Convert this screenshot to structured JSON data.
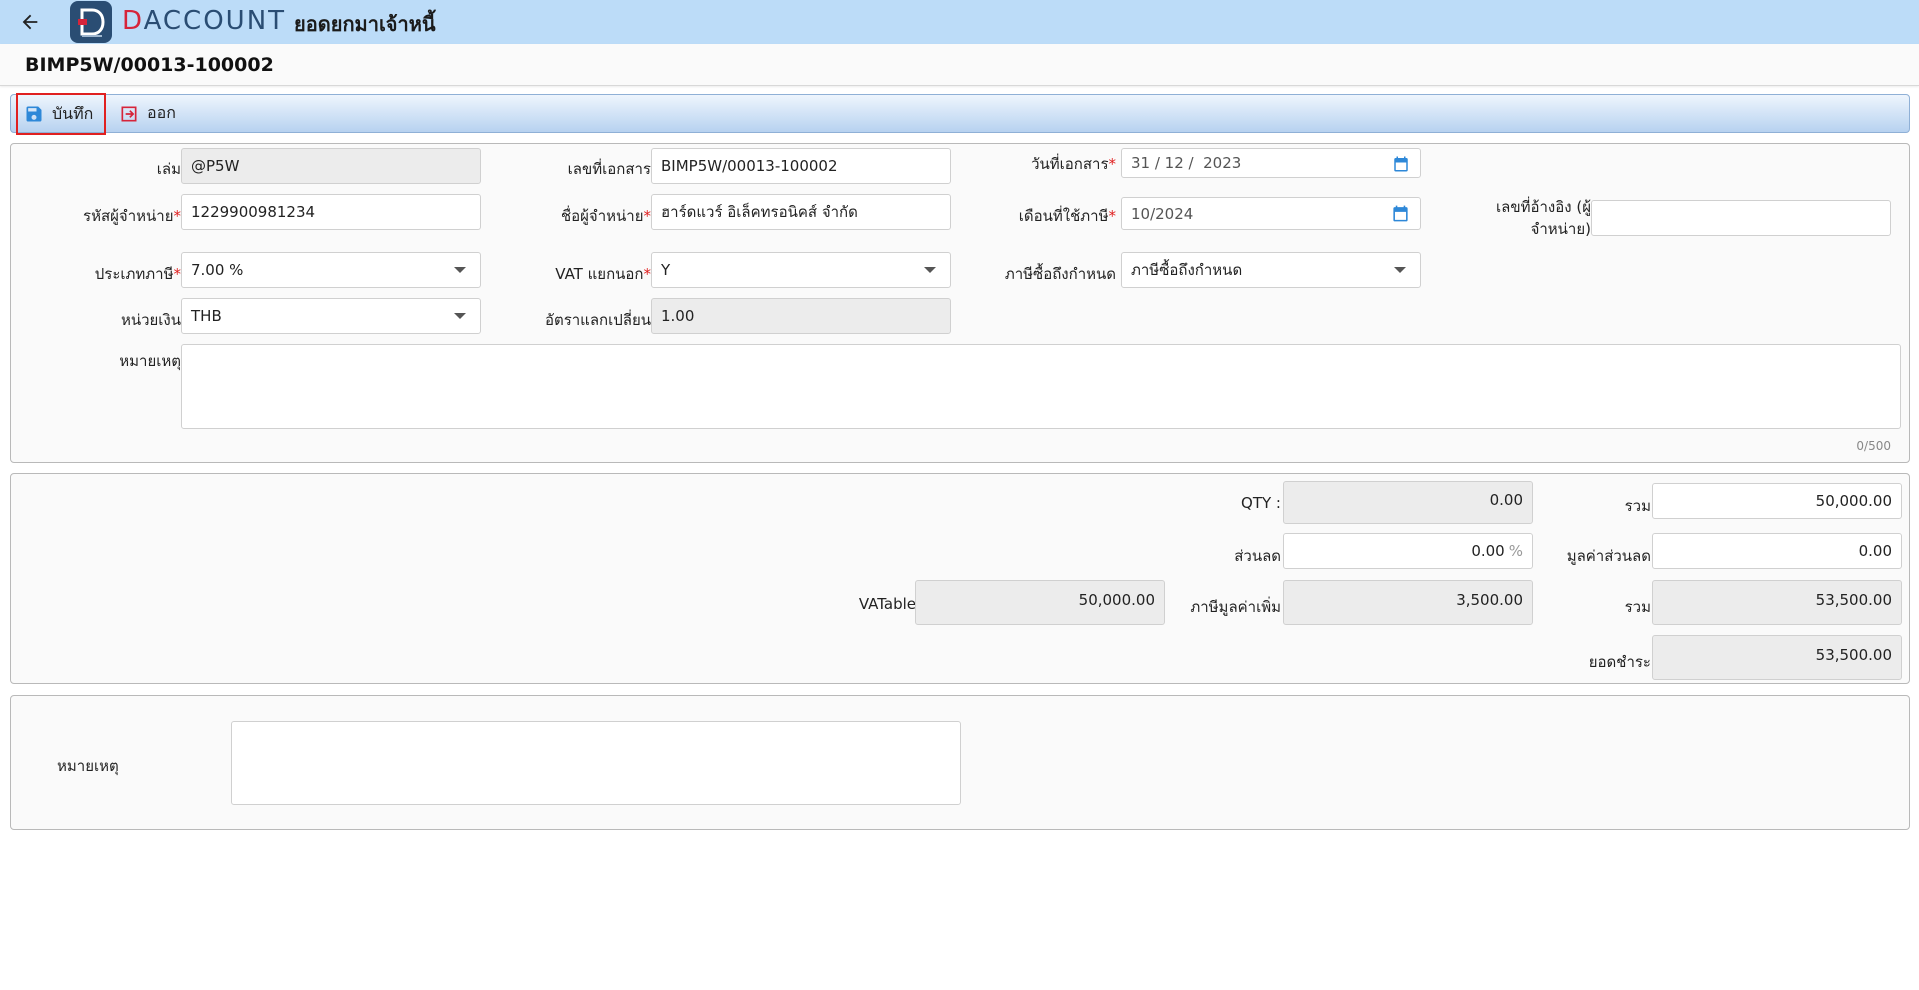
{
  "app": {
    "logo_text_d": "D",
    "logo_text_rest": "ACCOUNT",
    "title": "ยอดยกมาเจ้าหนี้"
  },
  "document": {
    "number": "BIMP5W/00013-100002"
  },
  "toolbar": {
    "save_label": "บันทึก",
    "exit_label": "ออก"
  },
  "form": {
    "book_label": "เล่ม",
    "book_value": "@P5W",
    "doc_no_label": "เลขที่เอกสาร",
    "doc_no_value": "BIMP5W/00013-100002",
    "doc_date_label": "วันที่เอกสาร",
    "doc_date_value": "31 / 12 /  2023",
    "vendor_code_label": "รหัสผู้จำหน่าย",
    "vendor_code_value": "1229900981234",
    "vendor_name_label": "ชื่อผู้จำหน่าย",
    "vendor_name_value": "ฮาร์ดแวร์ อิเล็คทรอนิคส์ จำกัด",
    "tax_month_label": "เดือนที่ใช้ภาษี",
    "tax_month_value": "10/2024",
    "ref_no_label_1": "เลขที่อ้างอิง (ผู้",
    "ref_no_label_2": "จำหน่าย)",
    "ref_no_value": "",
    "tax_type_label": "ประเภทภาษี",
    "tax_type_value": "7.00 %",
    "vat_separate_label": "VAT แยกนอก",
    "vat_separate_value": "Y",
    "purchase_tax_label": "ภาษีซื้อถึงกำหนด",
    "purchase_tax_value": "ภาษีซื้อถึงกำหนด",
    "currency_label": "หน่วยเงิน",
    "currency_value": "THB",
    "exchange_rate_label": "อัตราแลกเปลี่ยน",
    "exchange_rate_value": "1.00",
    "remark_label": "หมายเหตุ",
    "remark_value": "",
    "remark_counter": "0/500",
    "required_mark": "*"
  },
  "summary": {
    "qty_label": "QTY :",
    "qty_value": "0.00",
    "total_label": "รวม",
    "total_value": "50,000.00",
    "discount_label": "ส่วนลด",
    "discount_value": "0.00",
    "discount_unit": "%",
    "discount_amount_label": "มูลค่าส่วนลด",
    "discount_amount_value": "0.00",
    "vatable_label": "VATable",
    "vatable_value": "50,000.00",
    "vat_label": "ภาษีมูลค่าเพิ่ม",
    "vat_value": "3,500.00",
    "grand_total_label": "รวม",
    "grand_total_value": "53,500.00",
    "payable_label": "ยอดชำระ",
    "payable_value": "53,500.00"
  },
  "footer": {
    "remark_label": "หมายเหตุ",
    "remark_value": ""
  },
  "colors": {
    "appbar": "#bcdcf8",
    "brand_navy": "#2a4d73",
    "brand_red": "#d6243a",
    "required": "#e02020",
    "calendar_icon": "#2e88d8"
  }
}
